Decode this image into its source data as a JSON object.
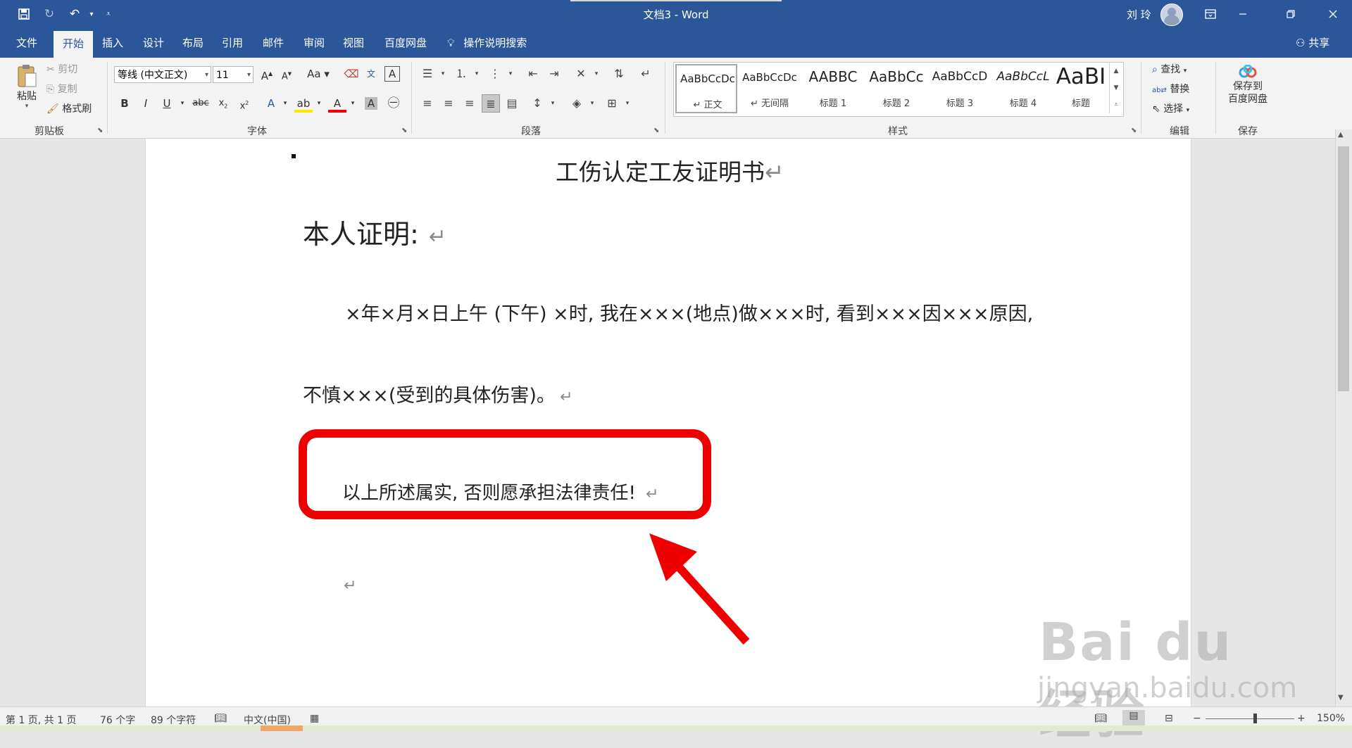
{
  "window": {
    "doc_name": "文档3",
    "title_sep": " - ",
    "app_name": "Word",
    "user_name": "刘 玲"
  },
  "tabs": [
    "文件",
    "开始",
    "插入",
    "设计",
    "布局",
    "引用",
    "邮件",
    "审阅",
    "视图",
    "百度网盘"
  ],
  "active_tab": "开始",
  "tell_me": "操作说明搜索",
  "share": "共享",
  "ribbon": {
    "clipboard": {
      "paste": "粘贴",
      "cut": "剪切",
      "copy": "复制",
      "format_painter": "格式刷",
      "label": "剪贴板"
    },
    "font": {
      "font_name": "等线 (中文正文)",
      "font_size": "11",
      "label": "字体"
    },
    "paragraph": {
      "label": "段落"
    },
    "styles": {
      "label": "样式",
      "items": [
        {
          "preview": "AaBbCcDc",
          "name": "↵ 正文"
        },
        {
          "preview": "AaBbCcDc",
          "name": "↵ 无间隔"
        },
        {
          "preview": "AABBC",
          "name": "标题 1"
        },
        {
          "preview": "AaBbCc",
          "name": "标题 2"
        },
        {
          "preview": "AaBbCcD",
          "name": "标题 3"
        },
        {
          "preview": "AaBbCcL",
          "name": "标题 4"
        },
        {
          "preview": "AaBI",
          "name": "标题"
        }
      ]
    },
    "editing": {
      "find": "查找",
      "replace": "替换",
      "select": "选择",
      "label": "编辑"
    },
    "save": {
      "save_to_line1": "保存到",
      "save_to_line2": "百度网盘",
      "label": "保存"
    }
  },
  "document": {
    "title": "工伤认定工友证明书",
    "heading": "本人证明:",
    "body_line1": "×年×月×日上午 (下午) ×时, 我在×××(地点)做×××时, 看到×××因×××原因,",
    "body_line2": "不慎×××(受到的具体伤害)。",
    "statement": "以上所述属实, 否则愿承担法律责任!",
    "paragraph_mark": "↵"
  },
  "watermark": {
    "brand": "Bai du 经验",
    "url": "jingyan.baidu.com"
  },
  "statusbar": {
    "page": "第 1 页, 共 1 页",
    "words": "76 个字",
    "chars": "89 个字符",
    "language": "中文(中国)",
    "zoom": "150%"
  },
  "colors": {
    "accent": "#2b579a",
    "callout": "#ee0000"
  }
}
